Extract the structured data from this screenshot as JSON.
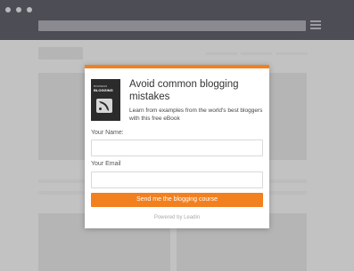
{
  "ebook_cover": {
    "line1": "BUSINESS",
    "line2": "BLOGGING"
  },
  "modal": {
    "title": "Avoid common blogging mistakes",
    "description": "Learn from examples from the world's best bloggers with this free eBook",
    "name_label": "Your Name:",
    "name_value": "",
    "email_label": "Your Email",
    "email_value": "",
    "submit_label": "Send me the blogging course",
    "powered_by": "Powered by Leadin"
  },
  "colors": {
    "accent": "#f2801f",
    "chrome": "#4d4d55",
    "overlay": "#c2c2c2"
  }
}
